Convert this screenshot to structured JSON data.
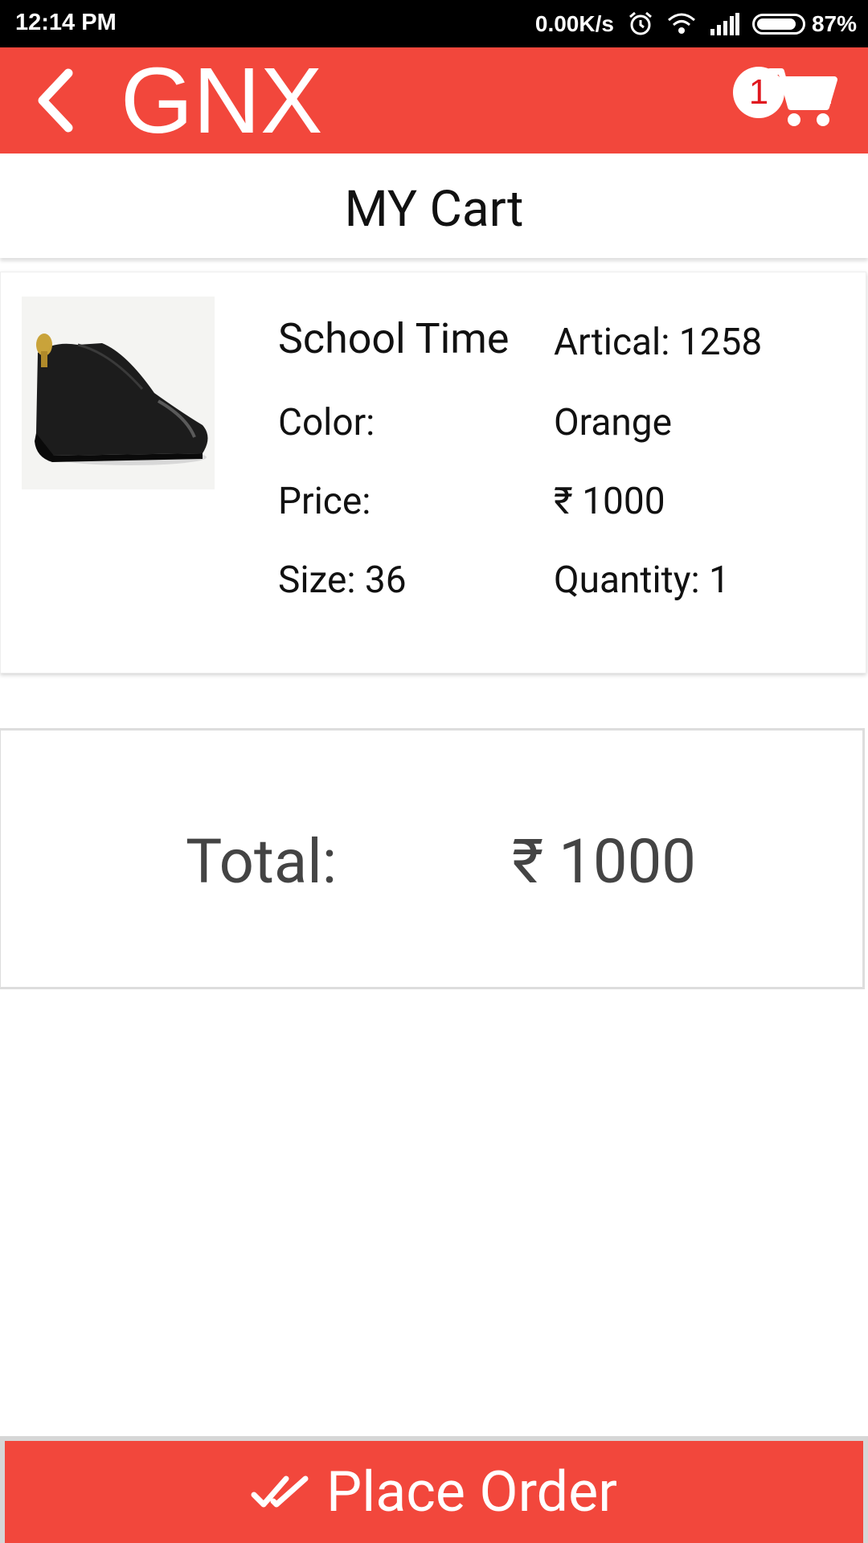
{
  "status_bar": {
    "time": "12:14 PM",
    "network_speed": "0.00K/s",
    "battery": "87%"
  },
  "app_bar": {
    "title": "GNX",
    "cart_count": "1",
    "icons": [
      "back-icon",
      "cart-icon"
    ],
    "color": "#f2473c"
  },
  "page": {
    "heading": "MY Cart"
  },
  "cart_item": {
    "name": "School Time",
    "article": "Artical: 1258",
    "color_label": "Color:",
    "color_value": "Orange",
    "price_label": "Price:",
    "price_value": "₹ 1000",
    "size": "Size: 36",
    "quantity": "Quantity: 1"
  },
  "summary": {
    "total_label": "Total:",
    "total_value": "₹ 1000"
  },
  "actions": {
    "place_order_label": "Place Order"
  }
}
